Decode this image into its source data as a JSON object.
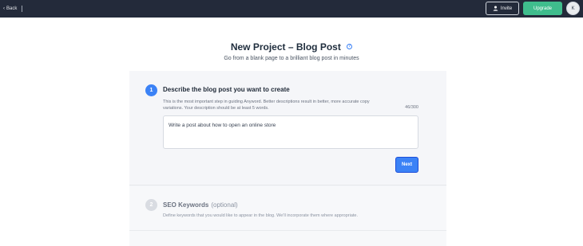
{
  "topbar": {
    "back_label": "Back",
    "invite_label": "Invite",
    "invite_icon": "user-icon",
    "upgrade_label": "Upgrade",
    "avatar_initial": "K",
    "colors": {
      "bar": "#232a3a",
      "upgrade": "#3fbd8d"
    }
  },
  "header": {
    "title": "New Project – Blog Post",
    "help_icon": "question-circle-icon",
    "subtitle": "Go from a blank page to a brilliant blog post in minutes"
  },
  "steps": [
    {
      "number": "1",
      "title": "Describe the blog post you want to create",
      "description": "This is the most important step in guiding Anyword. Better descriptions result in better, more accurate copy variations. Your description should be at least 5 words.",
      "counter": "46/300",
      "input_value": "Write a post about how to open an online store",
      "next_label": "Next",
      "state": "active"
    },
    {
      "number": "2",
      "title": "SEO Keywords",
      "title_suffix": "(optional)",
      "description": "Define keywords that you would like to appear in the blog. We'll incorporate them where appropriate.",
      "state": "inactive"
    }
  ],
  "accent_color": "#3b82f6"
}
